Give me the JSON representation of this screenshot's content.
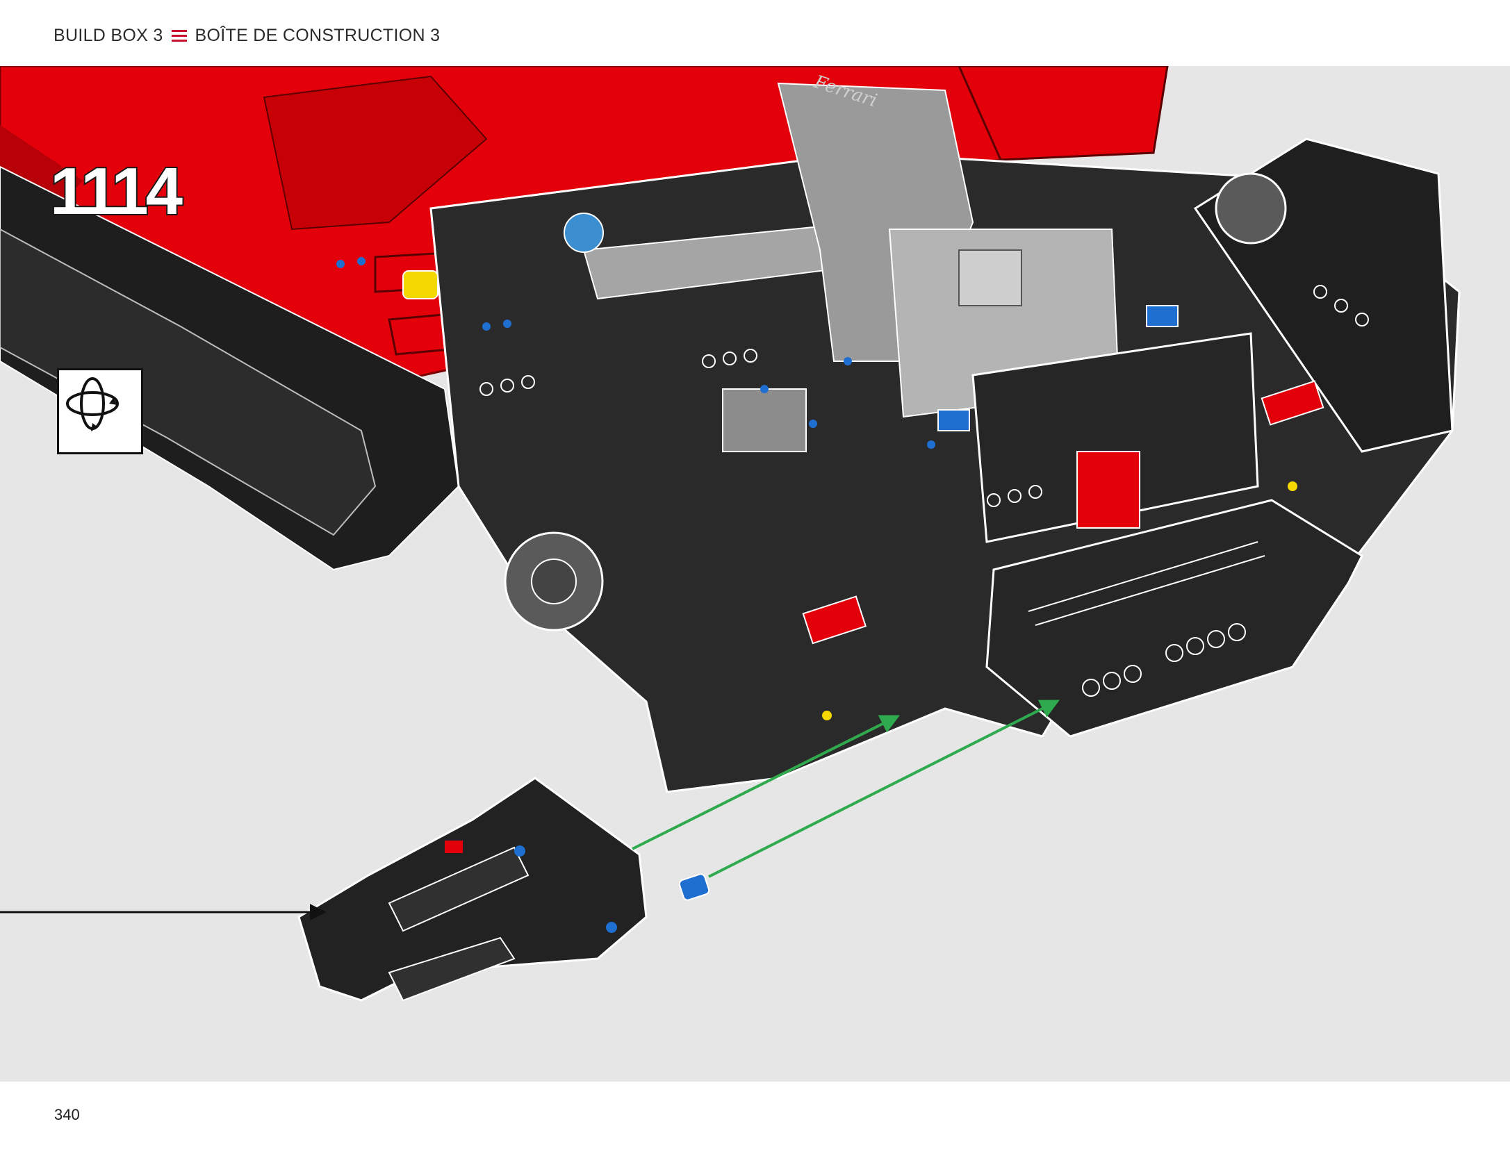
{
  "header": {
    "box_en": "BUILD BOX 3",
    "box_fr": "BOÎTE DE CONSTRUCTION 3",
    "divider_icon": "triple-line-icon",
    "accent_color": "#c8102e"
  },
  "step": {
    "number": "1114",
    "rotate_icon": "rotate-model-icon"
  },
  "illustration": {
    "emblem_text": "Ferrari",
    "arrow_color_assembly": "#2faa4e",
    "arrow_color_callout": "#111111",
    "part_colors": {
      "body": "#e3000b",
      "frame": "#1e1e1e",
      "beam_light": "#a5a5a5",
      "pin_blue": "#1f6fd1",
      "pin_yellow": "#f5d800",
      "pin_tan": "#d9b97a"
    }
  },
  "footer": {
    "page_number": "340"
  }
}
